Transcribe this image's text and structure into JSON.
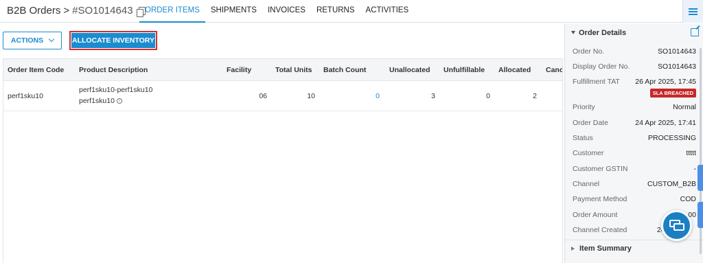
{
  "header": {
    "breadcrumb_root": "B2B Orders",
    "separator": ">",
    "order_code": "#SO1014643",
    "tabs": [
      {
        "label": "ORDER ITEMS",
        "active": true
      },
      {
        "label": "SHIPMENTS",
        "active": false
      },
      {
        "label": "INVOICES",
        "active": false
      },
      {
        "label": "RETURNS",
        "active": false
      },
      {
        "label": "ACTIVITIES",
        "active": false
      }
    ],
    "menu_icon": "hamburger-icon"
  },
  "toolbar": {
    "actions_label": "ACTIONS",
    "allocate_label": "ALLOCATE INVENTORY"
  },
  "grid": {
    "columns": [
      "Order Item Code",
      "Product Description",
      "Facility",
      "Total Units",
      "Batch Count",
      "Unallocated",
      "Unfulfillable",
      "Allocated",
      "Cance"
    ],
    "rows": [
      {
        "order_item_code": "perf1sku10",
        "product_line1": "perf1sku10-perf1sku10",
        "product_line2": "perf1sku10",
        "facility": "06",
        "total_units": "10",
        "batch_count": "0",
        "unallocated": "3",
        "unfulfillable": "0",
        "allocated": "2"
      }
    ]
  },
  "order_details": {
    "title": "Order Details",
    "fields": [
      {
        "label": "Order No.",
        "value": "SO1014643"
      },
      {
        "label": "Display Order No.",
        "value": "SO1014643"
      },
      {
        "label": "Fulfillment TAT",
        "value": "26 Apr 2025, 17:45",
        "badge": "SLA BREACHED"
      },
      {
        "label": "Priority",
        "value": "Normal"
      },
      {
        "label": "Order Date",
        "value": "24 Apr 2025, 17:41"
      },
      {
        "label": "Status",
        "value": "PROCESSING"
      },
      {
        "label": "Customer",
        "value": "ttttt"
      },
      {
        "label": "Customer GSTIN",
        "value": "-"
      },
      {
        "label": "Channel",
        "value": "CUSTOM_B2B"
      },
      {
        "label": "Payment Method",
        "value": "COD"
      },
      {
        "label": "Order Amount",
        "value": ".00"
      },
      {
        "label": "Channel Created",
        "value": "24 Apr 2"
      }
    ],
    "item_summary_label": "Item Summary"
  },
  "colors": {
    "accent": "#1b8ccf",
    "danger": "#c62828"
  }
}
